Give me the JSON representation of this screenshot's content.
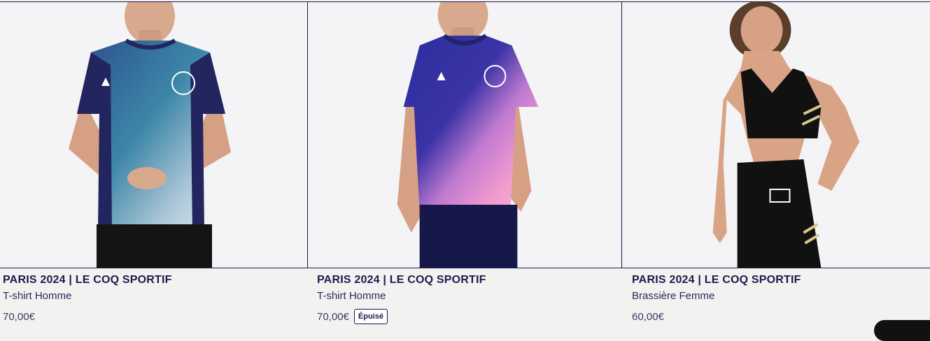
{
  "products": [
    {
      "brand": "PARIS 2024 | LE COQ SPORTIF",
      "type": "T-shirt Homme",
      "price": "70,00€",
      "badge": ""
    },
    {
      "brand": "PARIS 2024 | LE COQ SPORTIF",
      "type": "T-shirt Homme",
      "price": "70,00€",
      "badge": "Épuisé"
    },
    {
      "brand": "PARIS 2024 | LE COQ SPORTIF",
      "type": "Brassière Femme",
      "price": "60,00€",
      "badge": ""
    }
  ],
  "colors": {
    "navy": "#1b1b4d",
    "background": "#f3f2f1",
    "pink": "#f19ad0",
    "teal": "#2f7ca0"
  }
}
